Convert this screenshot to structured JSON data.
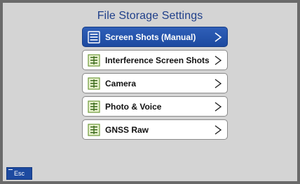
{
  "page": {
    "title": "File Storage Settings"
  },
  "menu": {
    "items": [
      {
        "label": "Screen Shots (Manual)",
        "icon": "document-list-icon",
        "selected": true
      },
      {
        "label": "Interference Screen Shots",
        "icon": "document-list-icon",
        "selected": false
      },
      {
        "label": "Camera",
        "icon": "document-list-icon",
        "selected": false
      },
      {
        "label": "Photo & Voice",
        "icon": "document-list-icon",
        "selected": false
      },
      {
        "label": "GNSS Raw",
        "icon": "document-list-icon",
        "selected": false
      }
    ]
  },
  "footer": {
    "esc_label": "Esc"
  },
  "colors": {
    "background": "#d4d4d4",
    "title": "#1f3f8a",
    "selected": "#1d4aa0",
    "frame": "#6a6a6a"
  }
}
